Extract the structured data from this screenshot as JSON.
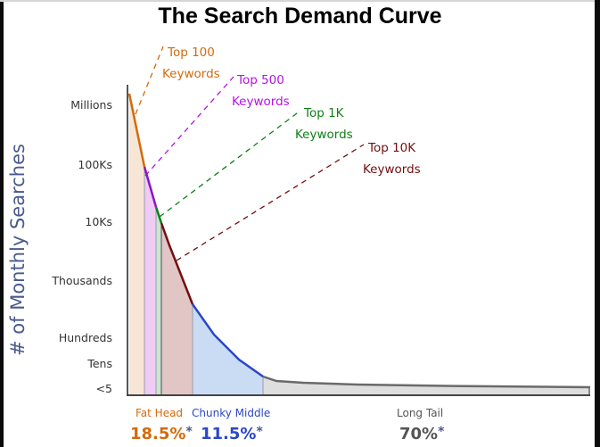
{
  "chart_data": {
    "type": "area",
    "title": "The Search Demand Curve",
    "xlabel": "",
    "ylabel": "# of Monthly Searches",
    "y_ticks": [
      "Millions",
      "100Ks",
      "10Ks",
      "Thousands",
      "Hundreds",
      "Tens",
      "<5"
    ],
    "y_scale": "log (qualitative)",
    "grid": false,
    "x_description": "Keywords ranked by search volume (long tail extends right)",
    "callouts": [
      {
        "line1": "Top 100",
        "line2": "Keywords",
        "color": "#d36a0b"
      },
      {
        "line1": "Top 500",
        "line2": "Keywords",
        "color": "#b313e6"
      },
      {
        "line1": "Top 1K",
        "line2": "Keywords",
        "color": "#0f7f17"
      },
      {
        "line1": "Top 10K",
        "line2": "Keywords",
        "color": "#730f10"
      }
    ],
    "curve_segments": [
      {
        "name": "Top 100",
        "color": "#d36a0b",
        "fill": "#f7e6d6"
      },
      {
        "name": "Top 500",
        "color": "#8a17c2",
        "fill": "#efcbf6"
      },
      {
        "name": "Top 1K",
        "color": "#0f7f17",
        "fill": "#cbe6cc"
      },
      {
        "name": "Top 10K",
        "color": "#730f10",
        "fill": "#e2c6c6"
      },
      {
        "name": "Chunky Middle",
        "color": "#2a46c9",
        "fill": "#c9dcf3"
      },
      {
        "name": "Long Tail",
        "color": "#6a6a6a",
        "fill": "#dedede"
      }
    ],
    "segments": [
      {
        "label": "Fat Head",
        "percent": 18.5,
        "percent_label": "18.5%",
        "asterisk": "*",
        "color": "#d36a0b"
      },
      {
        "label": "Chunky Middle",
        "percent": 11.5,
        "percent_label": "11.5%",
        "asterisk": "*",
        "color": "#2a46c9"
      },
      {
        "label": "Long Tail",
        "percent": 70,
        "percent_label": "70%",
        "asterisk": "*",
        "color": "#555555"
      }
    ]
  }
}
